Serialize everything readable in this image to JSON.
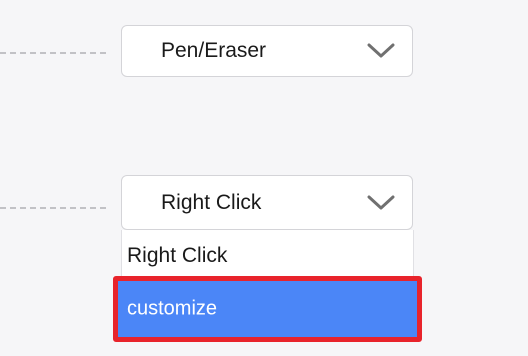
{
  "pen_setting": {
    "selected_value": "Pen/Eraser",
    "icon": "chevron-down-icon"
  },
  "button_setting": {
    "selected_value": "Right Click",
    "icon": "chevron-down-icon"
  },
  "dropdown": {
    "options": [
      {
        "label": "Right Click",
        "highlighted": false
      },
      {
        "label": "customize",
        "highlighted": true
      }
    ]
  },
  "colors": {
    "highlight_background": "#4b86f7",
    "annotation_border": "#e8232b"
  }
}
